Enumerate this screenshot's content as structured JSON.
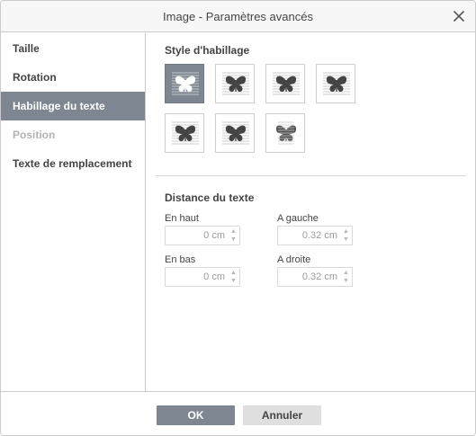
{
  "dialog": {
    "title": "Image - Paramètres avancés",
    "close_icon": "close-icon"
  },
  "sidebar": {
    "items": [
      {
        "label": "Taille",
        "state": "normal"
      },
      {
        "label": "Rotation",
        "state": "normal"
      },
      {
        "label": "Habillage du texte",
        "state": "active"
      },
      {
        "label": "Position",
        "state": "disabled"
      },
      {
        "label": "Texte de remplacement",
        "state": "normal"
      }
    ]
  },
  "wrapping": {
    "heading": "Style d'habillage",
    "styles": [
      {
        "icon": "wrap-inline-icon",
        "selected": true
      },
      {
        "icon": "wrap-square-icon",
        "selected": false
      },
      {
        "icon": "wrap-tight-icon",
        "selected": false
      },
      {
        "icon": "wrap-through-icon",
        "selected": false
      },
      {
        "icon": "wrap-top-bottom-icon",
        "selected": false
      },
      {
        "icon": "wrap-in-front-icon",
        "selected": false
      },
      {
        "icon": "wrap-behind-icon",
        "selected": false
      }
    ]
  },
  "distance": {
    "heading": "Distance du texte",
    "top": {
      "label": "En haut",
      "value": "0 cm"
    },
    "bottom": {
      "label": "En bas",
      "value": "0 cm"
    },
    "left": {
      "label": "A gauche",
      "value": "0.32 cm"
    },
    "right": {
      "label": "A droite",
      "value": "0.32 cm"
    }
  },
  "footer": {
    "ok_label": "OK",
    "cancel_label": "Annuler"
  },
  "colors": {
    "accent": "#7e8791",
    "border": "#cbcbcb",
    "titlebar": "#f7f7f7",
    "cancel_bg": "#dfdfdf"
  }
}
